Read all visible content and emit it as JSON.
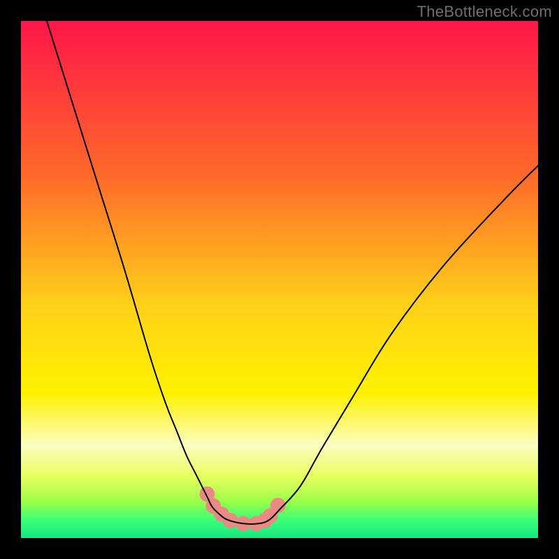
{
  "watermark": "TheBottleneck.com",
  "chart_data": {
    "type": "line",
    "title": "",
    "xlabel": "",
    "ylabel": "",
    "xlim": [
      0,
      100
    ],
    "ylim": [
      0,
      100
    ],
    "grid": false,
    "legend": false,
    "gradient_stops": [
      {
        "offset": 0,
        "color": "#ff1649"
      },
      {
        "offset": 0.3,
        "color": "#ff6a2a"
      },
      {
        "offset": 0.55,
        "color": "#ffd11a"
      },
      {
        "offset": 0.72,
        "color": "#fef200"
      },
      {
        "offset": 0.82,
        "color": "#fdfdc2"
      },
      {
        "offset": 0.88,
        "color": "#e8ff5e"
      },
      {
        "offset": 0.93,
        "color": "#9bff4a"
      },
      {
        "offset": 0.965,
        "color": "#3bff77"
      },
      {
        "offset": 1.0,
        "color": "#16e780"
      }
    ],
    "series": [
      {
        "name": "curve",
        "color": "#000000",
        "stroke_width": 2,
        "x": [
          5,
          10,
          15,
          20,
          25,
          28,
          30,
          32,
          34,
          36,
          37,
          38.5,
          40,
          43,
          46,
          48,
          50,
          54,
          58,
          64,
          72,
          82,
          94,
          100
        ],
        "y": [
          100,
          84,
          68,
          52,
          35,
          26,
          21,
          16,
          12,
          8,
          6,
          4.5,
          3.5,
          2.8,
          2.8,
          3.5,
          5.5,
          10,
          17,
          27,
          40,
          53,
          66,
          72
        ]
      },
      {
        "name": "highlight",
        "color": "#e98a84",
        "type": "scatter",
        "marker_size": 22,
        "x": [
          36,
          37.2,
          38.8,
          40.5,
          43,
          45.5,
          47.2,
          48.2,
          49.7
        ],
        "y": [
          8.5,
          6.2,
          4.6,
          3.4,
          2.8,
          2.8,
          3.4,
          4.3,
          6.3
        ]
      }
    ]
  }
}
